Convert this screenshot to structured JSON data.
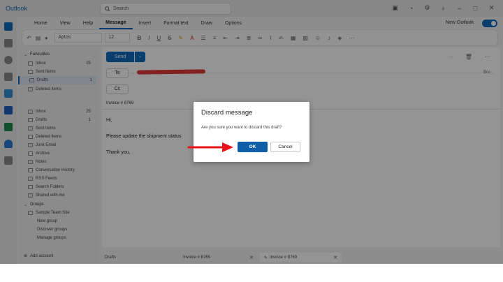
{
  "window": {
    "app_name": "Outlook"
  },
  "search": {
    "placeholder": "Search"
  },
  "ribbon": {
    "tabs": [
      "Home",
      "View",
      "Help",
      "Message",
      "Insert",
      "Format text",
      "Draw",
      "Options"
    ],
    "active_tab": "Message",
    "new_outlook_label": "New Outlook",
    "font_name": "Aptos",
    "font_size": "12"
  },
  "folders": {
    "favourites_label": "Favourites",
    "favourites": [
      {
        "label": "Inbox",
        "count": "25"
      },
      {
        "label": "Sent Items",
        "count": ""
      },
      {
        "label": "Drafts",
        "count": "1"
      },
      {
        "label": "Deleted Items",
        "count": ""
      }
    ],
    "mailbox": [
      {
        "label": "Inbox",
        "count": "25"
      },
      {
        "label": "Drafts",
        "count": "1"
      },
      {
        "label": "Sent Items",
        "count": ""
      },
      {
        "label": "Deleted Items",
        "count": ""
      },
      {
        "label": "Junk Email",
        "count": ""
      },
      {
        "label": "Archive",
        "count": ""
      },
      {
        "label": "Notes",
        "count": ""
      },
      {
        "label": "Conversation History",
        "count": ""
      },
      {
        "label": "RSS Feeds",
        "count": ""
      },
      {
        "label": "Search Folders",
        "count": ""
      },
      {
        "label": "Shared with me",
        "count": ""
      }
    ],
    "groups_label": "Groups",
    "groups": [
      "Sample Team Site"
    ],
    "group_actions": [
      "New group",
      "Discover groups",
      "Manage groups"
    ],
    "add_account": "Add account"
  },
  "compose": {
    "send_label": "Send",
    "to_label": "To",
    "cc_label": "Cc",
    "bcc_label": "Bcc",
    "subject": "Invoice # 8769",
    "body": [
      "Hi,",
      "Please update the shipment status",
      "Thank you,"
    ]
  },
  "bottom_tabs": [
    {
      "label": "Drafts"
    },
    {
      "label": "Invoice # 8769"
    },
    {
      "label": "Invoice # 8769"
    }
  ],
  "dialog": {
    "title": "Discard message",
    "message": "Are you sure you want to discard this draft?",
    "ok_label": "OK",
    "cancel_label": "Cancel"
  },
  "colors": {
    "accent": "#0f6cbd",
    "ok_button": "#0f5ea8",
    "annotation_arrow": "#e8141b",
    "redaction": "#e23a3a"
  }
}
